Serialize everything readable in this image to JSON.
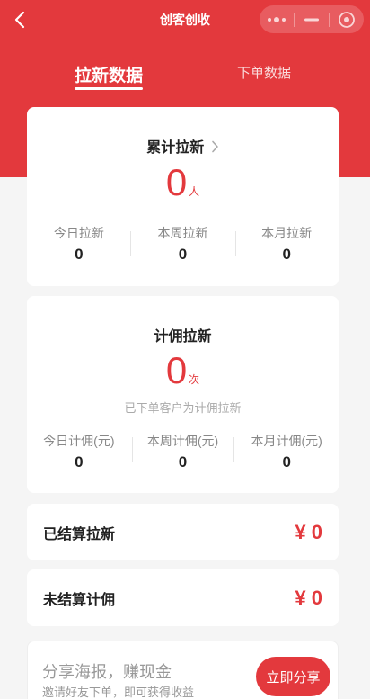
{
  "nav": {
    "title": "创客创收"
  },
  "tabs": [
    {
      "label": "拉新数据",
      "active": true
    },
    {
      "label": "下单数据",
      "active": false
    }
  ],
  "total_card": {
    "title": "累计拉新",
    "value": "0",
    "unit": "人",
    "stats": [
      {
        "label": "今日拉新",
        "value": "0"
      },
      {
        "label": "本周拉新",
        "value": "0"
      },
      {
        "label": "本月拉新",
        "value": "0"
      }
    ]
  },
  "commission_card": {
    "title": "计佣拉新",
    "value": "0",
    "unit": "次",
    "note": "已下单客户为计佣拉新",
    "stats": [
      {
        "label": "今日计佣(元)",
        "value": "0"
      },
      {
        "label": "本周计佣(元)",
        "value": "0"
      },
      {
        "label": "本月计佣(元)",
        "value": "0"
      }
    ]
  },
  "settled": {
    "label": "已结算拉新",
    "amount": "¥ 0"
  },
  "unsettled": {
    "label": "未结算计佣",
    "amount": "¥ 0"
  },
  "share": {
    "title": "分享海报，赚现金",
    "subtitle": "邀请好友下单，即可获得收益",
    "button": "立即分享"
  },
  "colors": {
    "brand": "#e3393d",
    "background": "#f5f5f5"
  }
}
